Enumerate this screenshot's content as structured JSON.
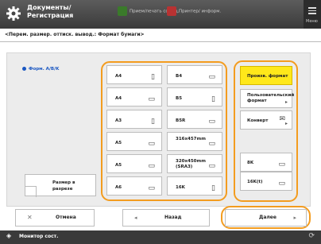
{
  "header": {
    "title": "Документы/ Регистрация",
    "status_1": "Прием/печать сообщ.",
    "status_2": "Принтер/ информ.",
    "menu_label": "Меню"
  },
  "subtitle": "<Перем. размер. оттиск. вывод.: Формат бумаги>",
  "left": {
    "radio_label": "Форм. A/B/K",
    "size_button": "Размер в разрезе"
  },
  "paper_grid": [
    {
      "label": "A4",
      "icon": "portrait-icon"
    },
    {
      "label": "B4",
      "icon": "landscape-icon"
    },
    {
      "label": "A4",
      "icon": "landscape-icon"
    },
    {
      "label": "B5",
      "icon": "portrait-icon"
    },
    {
      "label": "A3",
      "icon": "portrait-icon"
    },
    {
      "label": "B5R",
      "icon": "landscape-icon"
    },
    {
      "label": "A5",
      "icon": "landscape-icon"
    },
    {
      "label": "316x457mm",
      "icon": "landscape-icon"
    },
    {
      "label": "A5",
      "icon": "landscape-icon"
    },
    {
      "label": "320x450mm (SRA3)",
      "icon": "landscape-icon"
    },
    {
      "label": "A6",
      "icon": "landscape-icon"
    },
    {
      "label": "16K",
      "icon": "portrait-icon"
    }
  ],
  "side_buttons": [
    {
      "label": "Произв. формат",
      "selected": true
    },
    {
      "label": "Пользовательский формат",
      "selected": false
    },
    {
      "label": "Конверт",
      "selected": false
    },
    {
      "label": "8K",
      "selected": false
    },
    {
      "label": "16K(t)",
      "selected": false
    }
  ],
  "bottom": {
    "cancel": "Отмена",
    "back": "Назад",
    "next": "Далее"
  },
  "statusbar": {
    "monitor": "Монитор сост."
  },
  "colors": {
    "highlight": "#f39c1f",
    "selected": "#ffe81a"
  }
}
